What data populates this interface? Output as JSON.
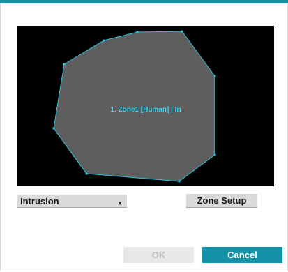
{
  "colors": {
    "accent": "#1592a8",
    "zone_fill": "#5e5e5e",
    "zone_outline": "#2ec4dd",
    "zone_label": "#3fd6ec"
  },
  "zone": {
    "label": "1. Zone1 [Human] | In"
  },
  "detection": {
    "selected_option": "Intrusion",
    "dropdown_icon": "chevron-down-icon"
  },
  "buttons": {
    "zone_setup": "Zone Setup",
    "ok": "OK",
    "cancel": "Cancel"
  }
}
